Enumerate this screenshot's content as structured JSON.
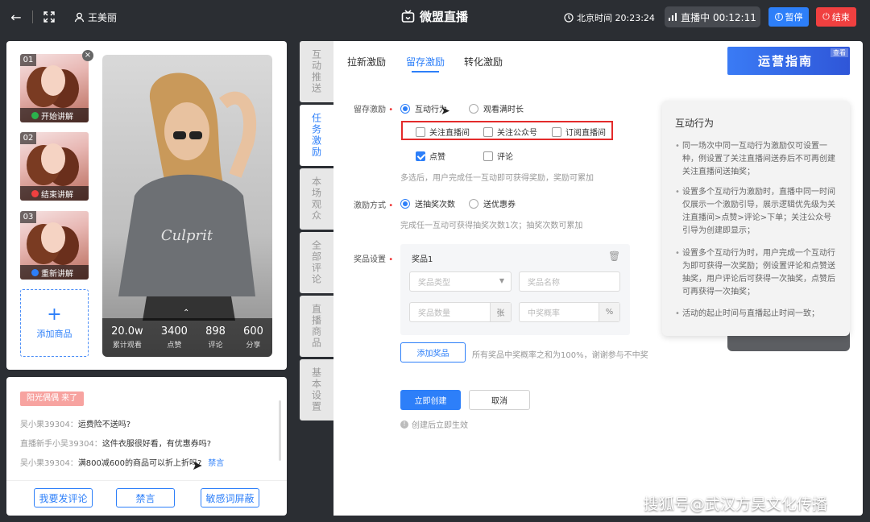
{
  "header": {
    "streamer_name": "王美丽",
    "title": "微盟直播",
    "time_label": "北京时间 20:23:24",
    "live_status": "直播中 00:12:11",
    "pause_label": "暂停",
    "end_label": "结束"
  },
  "left": {
    "clips": [
      {
        "num": "01",
        "label": "开始讲解",
        "dot_color": "#2bb24c"
      },
      {
        "num": "02",
        "label": "结束讲解",
        "dot_color": "#f04040"
      },
      {
        "num": "03",
        "label": "重新讲解",
        "dot_color": "#2d7ff9"
      }
    ],
    "add_label": "添加商品",
    "stats": [
      {
        "value": "20.0w",
        "label": "累计观看"
      },
      {
        "value": "3400",
        "label": "点赞"
      },
      {
        "value": "898",
        "label": "评论"
      },
      {
        "value": "600",
        "label": "分享"
      }
    ]
  },
  "chat": {
    "banner": "阳光偶偶 来了",
    "messages": [
      {
        "user": "吴小果39304：",
        "text": "运费险不送吗?"
      },
      {
        "user": "直播新手小吴39304：",
        "text": "这件衣服很好看，有优惠券吗?"
      },
      {
        "user": "吴小果39304：",
        "text": "满800减600的商品可以折上折吗?",
        "action": "禁言"
      }
    ],
    "buttons": [
      "我要发评论",
      "禁言",
      "敏感词屏蔽"
    ]
  },
  "side_tabs": [
    "互动推送",
    "任务激励",
    "本场观众",
    "全部评论",
    "直播商品",
    "基本设置"
  ],
  "main": {
    "tabs": [
      "拉新激励",
      "留存激励",
      "转化激励"
    ],
    "guide_banner": "运营指南",
    "guide_tag": "查看",
    "retention_label": "留存激励",
    "retention_options": [
      "互动行为",
      "观看满时长"
    ],
    "follow_checks": [
      "关注直播间",
      "关注公众号",
      "订阅直播间"
    ],
    "extra_checks": [
      "点赞",
      "评论"
    ],
    "retention_hint": "多选后，用户完成任一互动即可获得奖励，奖励可累加",
    "method_label": "激励方式",
    "method_options": [
      "送抽奖次数",
      "送优惠券"
    ],
    "method_hint": "完成任一互动可获得抽奖次数1次；抽奖次数可累加",
    "prize_label": "奖品设置",
    "prize_title": "奖品1",
    "prize_type_ph": "奖品类型",
    "prize_name_ph": "奖品名称",
    "prize_qty_ph": "奖品数量",
    "prize_qty_unit": "张",
    "prize_rate_ph": "中奖概率",
    "prize_rate_unit": "%",
    "add_prize": "添加奖品",
    "add_prize_hint": "所有奖品中奖概率之和为100%，谢谢参与不中奖",
    "create": "立即创建",
    "cancel": "取消",
    "footer_hint": "创建后立即生效"
  },
  "side_card": {
    "title": "互动行为",
    "items": [
      "同一场次中同一互动行为激励仅可设置一种，例设置了关注直播间送券后不可再创建关注直播间送抽奖；",
      "设置多个互动行为激励时，直播中同一时间仅展示一个激励引导，展示逻辑优先级为关注直播间>点赞>评论>下单；关注公众号引导为创建即显示；",
      "设置多个互动行为时，用户完成一个互动行为即可获得一次奖励；例设置评论和点赞送抽奖，用户评论后可获得一次抽奖，点赞后可再获得一次抽奖；",
      "活动的起止时间与直播起止时间一致；"
    ]
  },
  "watermark": "搜狐号@武汉方昊文化传播",
  "colors": {
    "accent": "#2d7ff9",
    "danger": "#f04040",
    "highlight_box": "#e32b2b"
  }
}
